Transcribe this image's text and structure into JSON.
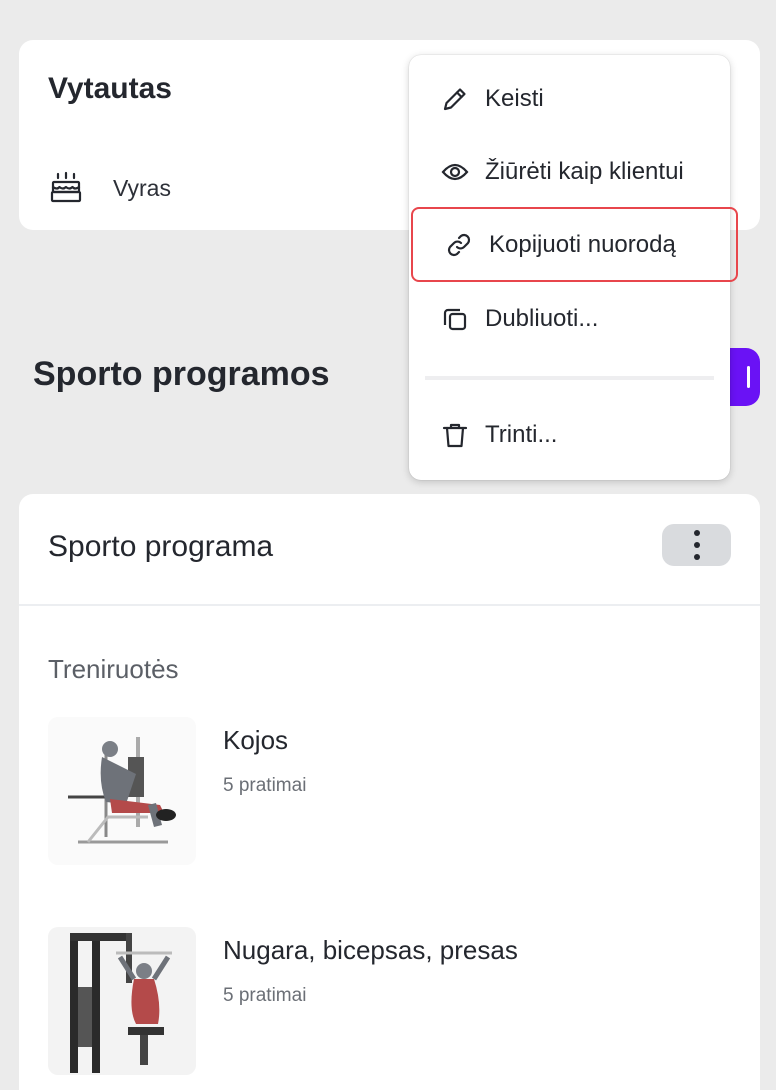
{
  "client": {
    "name": "Vytautas",
    "gender": "Vyras",
    "gender_icon": "cake-icon"
  },
  "programs_section": {
    "title": "Sporto programos"
  },
  "program_card": {
    "title": "Sporto programa",
    "workouts_label": "Treniruotės",
    "workouts": [
      {
        "name": "Kojos",
        "count": "5 pratimai"
      },
      {
        "name": "Nugara, bicepsas, presas",
        "count": "5 pratimai"
      }
    ]
  },
  "menu": {
    "items": [
      {
        "label": "Keisti",
        "icon": "pencil-icon"
      },
      {
        "label": "Žiūrėti kaip klientui",
        "icon": "eye-icon"
      },
      {
        "label": "Kopijuoti nuorodą",
        "icon": "link-icon",
        "highlighted": true
      },
      {
        "label": "Dubliuoti...",
        "icon": "copy-icon"
      },
      {
        "label": "Trinti...",
        "icon": "trash-icon"
      }
    ]
  },
  "colors": {
    "accent": "#6a12f5",
    "highlight_border": "#e8464c",
    "background": "#ebebeb"
  }
}
